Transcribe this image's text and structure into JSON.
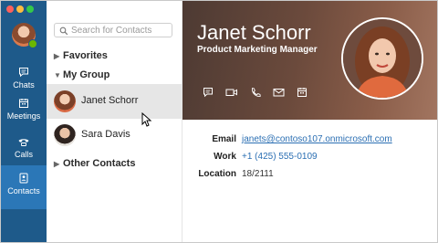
{
  "rail": {
    "items": [
      {
        "label": "Chats",
        "icon": "chat-icon"
      },
      {
        "label": "Meetings",
        "icon": "calendar-icon"
      },
      {
        "label": "Calls",
        "icon": "phone-icon"
      },
      {
        "label": "Contacts",
        "icon": "contacts-icon"
      }
    ],
    "active": "Contacts",
    "colors": {
      "rail": "#1e5a8a",
      "active": "#2b77b7",
      "presence": "#6bb700"
    }
  },
  "list": {
    "search_placeholder": "Search for Contacts",
    "groups": {
      "favorites": "Favorites",
      "my_group": "My Group",
      "other": "Other Contacts"
    },
    "contacts": [
      {
        "name": "Janet Schorr",
        "selected": true
      },
      {
        "name": "Sara Davis",
        "selected": false
      }
    ]
  },
  "detail": {
    "name": "Janet Schorr",
    "title": "Product Marketing Manager",
    "actions": [
      "chat-icon",
      "video-icon",
      "phone-icon",
      "mail-icon",
      "calendar-icon"
    ],
    "fields": {
      "email_label": "Email",
      "email_value": "janets@contoso107.onmicrosoft.com",
      "work_label": "Work",
      "work_value": "+1 (425) 555-0109",
      "location_label": "Location",
      "location_value": "18/2111"
    }
  }
}
